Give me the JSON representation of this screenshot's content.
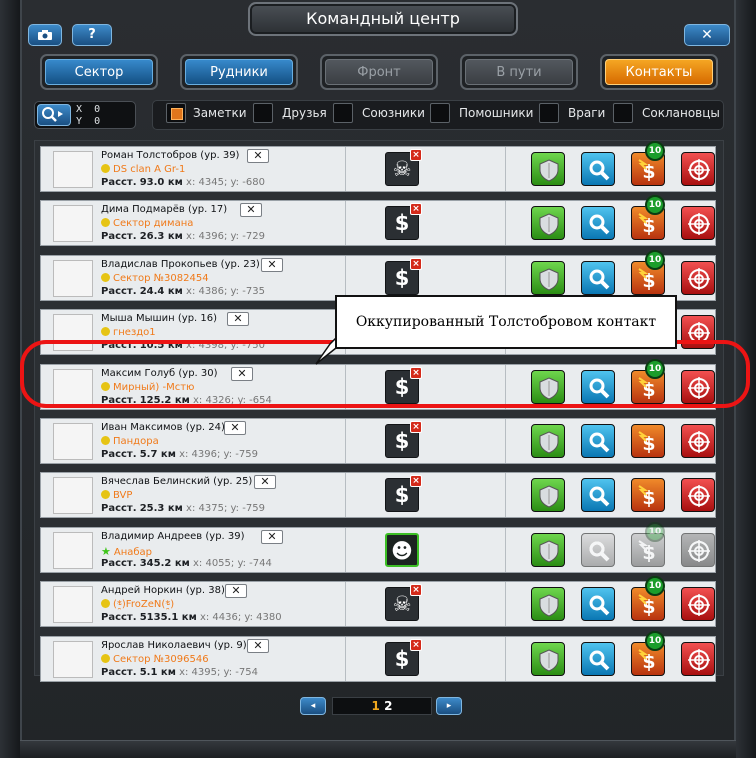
{
  "window": {
    "title": "Командный центр",
    "close_label": "✕",
    "help_label": "?"
  },
  "tabs": [
    {
      "label": "Сектор",
      "state": "normal"
    },
    {
      "label": "Рудники",
      "state": "normal"
    },
    {
      "label": "Фронт",
      "state": "disabled"
    },
    {
      "label": "В пути",
      "state": "disabled"
    },
    {
      "label": "Контакты",
      "state": "active"
    }
  ],
  "coords": {
    "x_label": "X",
    "x_value": "0",
    "y_label": "Y",
    "y_value": "0"
  },
  "filters": [
    {
      "label": "Заметки",
      "checked": true
    },
    {
      "label": "Друзья",
      "checked": false
    },
    {
      "label": "Союзники",
      "checked": false
    },
    {
      "label": "Помошники",
      "checked": false
    },
    {
      "label": "Враги",
      "checked": false
    },
    {
      "label": "Соклановцы",
      "checked": false
    }
  ],
  "contacts": [
    {
      "name": "Роман Толстобров (ур. 39)",
      "clan": "DS clan A Gr-1",
      "dist": "93.0 км",
      "coords": "x: 4345; y: -680",
      "mid_icon": "skull-icon",
      "badge": "10",
      "dimmed": false
    },
    {
      "name": "Дима Подмарёв (ур. 17)",
      "clan": "Сектор димана",
      "dist": "26.3 км",
      "coords": "x: 4396; y: -729",
      "mid_icon": "dollar-icon",
      "badge": "10",
      "dimmed": false
    },
    {
      "name": "Владислав Прокопьев (ур. 23)",
      "clan": "Сектор №3082454",
      "dist": "24.4 км",
      "coords": "x: 4386; y: -735",
      "mid_icon": "dollar-icon",
      "badge": "10",
      "dimmed": false
    },
    {
      "name": "Мыша Мышин (ур. 16)",
      "clan": "гнездо1",
      "dist": "10.5 км",
      "coords": "x: 4398; y: -750",
      "mid_icon": "dollar-icon",
      "badge": "",
      "dimmed": false
    },
    {
      "name": "Максим Голуб (ур. 30)",
      "clan": "Мирный) -Мстю",
      "dist": "125.2 км",
      "coords": "x: 4326; y: -654",
      "mid_icon": "dollar-icon",
      "badge": "10",
      "dimmed": false
    },
    {
      "name": "Иван Максимов (ур. 24)",
      "clan": "Пандора",
      "dist": "5.7 км",
      "coords": "x: 4396; y: -759",
      "mid_icon": "dollar-icon",
      "badge": "",
      "dimmed": false
    },
    {
      "name": "Вячеслав Белинский (ур. 25)",
      "clan": "BVP",
      "dist": "25.3 км",
      "coords": "x: 4375; y: -759",
      "mid_icon": "dollar-icon",
      "badge": "",
      "dimmed": false
    },
    {
      "name": "Владимир Андреев (ур. 39)",
      "clan": "Анабар",
      "dist": "345.2 км",
      "coords": "x: 4055; y: -744",
      "mid_icon": "smiley-icon",
      "badge": "10",
      "dimmed": true
    },
    {
      "name": "Андрей Норкин (ур. 38)",
      "clan": "(*̵̯)FroZeN(*̵̯)",
      "dist": "5135.1 км",
      "coords": "x: 4436; y: 4380",
      "mid_icon": "skull-icon",
      "badge": "10",
      "dimmed": false
    },
    {
      "name": "Ярослав Николаевич (ур. 9)",
      "clan": "Сектор №3096546",
      "dist": "5.1 км",
      "coords": "x: 4395; y: -754",
      "mid_icon": "dollar-icon",
      "badge": "10",
      "dimmed": false
    }
  ],
  "row_dist_prefix": "Расст.",
  "row_remove_label": "✕",
  "pager": {
    "current": "1",
    "other": "2",
    "prev": "◂",
    "next": "▸"
  },
  "annotation": {
    "text": "Оккупированный Толстобровом контакт",
    "color": "#ec1414"
  }
}
